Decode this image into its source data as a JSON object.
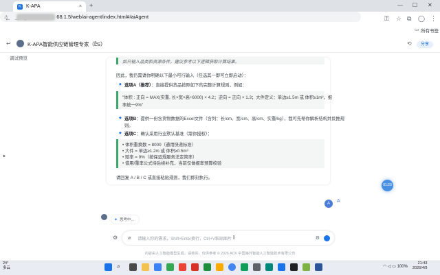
{
  "browser": {
    "tab_title": "K-APA",
    "tab_close": "×",
    "new_tab": "+",
    "url": "68.1.5/web/ai-agent/index.html#/aiAgent",
    "bookmarks": "所有书签"
  },
  "app": {
    "title": "K-APA智能供应链管理专家（LS）",
    "share_label": "分享",
    "left_label": "调试预览"
  },
  "message": {
    "top_quote": "如只输入品类和资源条件，建议参考以下逻辑获取计算结果。",
    "intro": "因此，我仍需请你明确以下最小可行输入（任选其一即可立即启动）：",
    "option_a_title": "选项A（推荐）",
    "option_a_text": "：直接提供货品按照如下的完整计算规则，例如：",
    "option_a_quote_1": "\"体积 : 正向 = MAX(实重, 长×宽×高÷6000) × 4.2；逆向 = 正向 × 1.3；大件定义：单边≥1.5m 或 体积≥1m³，报",
    "option_a_quote_2": "率统一9%\"",
    "option_b_title": "选项B",
    "option_b_text": "：提供一份含货物数据的Excel文件（含列：长/cm、宽/cm、高/cm、实重/kg），我可先帮你解析结构并反推规",
    "option_b_text_2": "则。",
    "option_c_title": "选项C",
    "option_c_text": "：确认采用行业默认基准（需你授权）：",
    "option_c_items": [
      "• 体积重换数 = 8000（通用快递标准）",
      "• 大件 = 单边≥1.2m 或 体积≥0.5m³",
      "• 赔率 = 9%（按保运规服务法定简率）",
      "• 借用/重率公式待后续补充，当前仅做报率预算校验"
    ],
    "closing": "请回复 A / B / C 或直接粘贴规则，我们即刻执行。"
  },
  "side": {
    "scroll_badge": "01:20",
    "user_initial": "A",
    "user_letter": "A"
  },
  "thinking_label": "思考中...",
  "input": {
    "placeholder": "请输入你的需求，Shift+Enter换行，Ctrl+V粘贴图片"
  },
  "footer": "内容由人工智能模型生成，请核实，仅供参考 © 2026 ACK 中国海外智能人工智能技术有限公司",
  "taskbar": {
    "weather": "24°",
    "weather_sub": "多云",
    "battery": "100%",
    "time": "21:43",
    "date": "2026/4/9"
  },
  "colors": {
    "accent": "#1a73e8",
    "quote_border": "#3aa86b"
  }
}
